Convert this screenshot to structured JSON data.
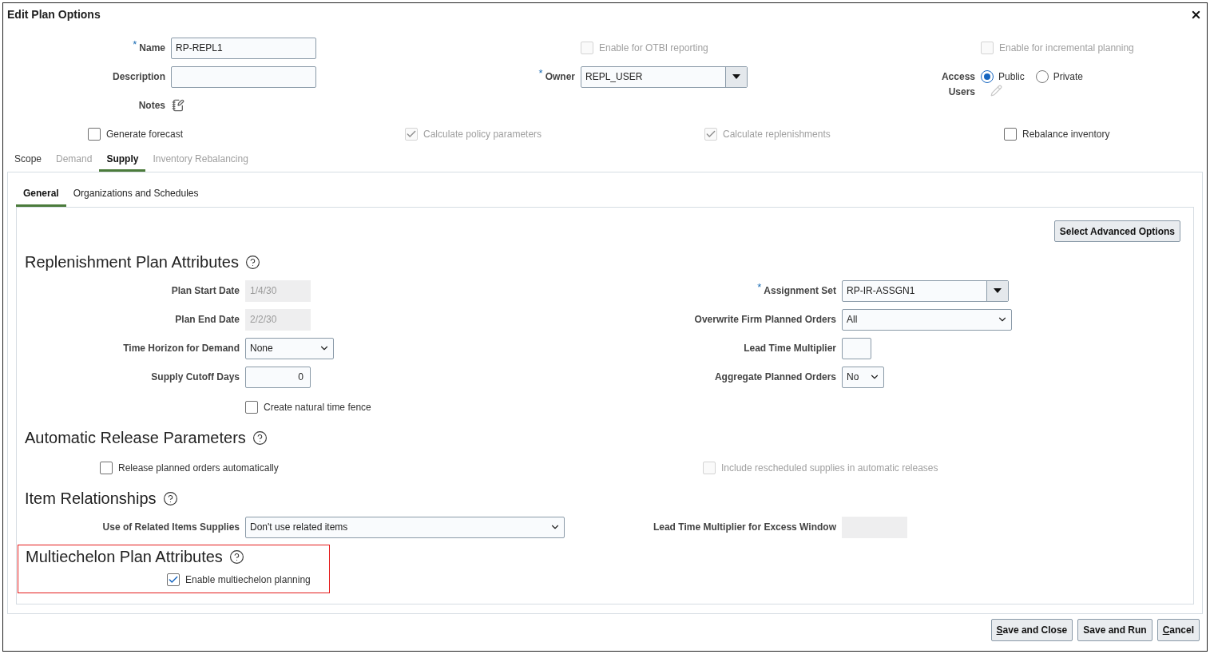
{
  "window": {
    "title": "Edit Plan Options"
  },
  "header": {
    "name": {
      "label": "Name",
      "required_mark": "*",
      "value": "RP-REPL1"
    },
    "description": {
      "label": "Description"
    },
    "notes": {
      "label": "Notes"
    },
    "otbi": {
      "label": "Enable for OTBI reporting",
      "checked": false,
      "disabled": true
    },
    "owner": {
      "label": "Owner",
      "required_mark": "*",
      "value": "REPL_USER"
    },
    "incremental": {
      "label": "Enable for incremental planning",
      "checked": false,
      "disabled": true
    },
    "access": {
      "label": "Access",
      "options": [
        {
          "label": "Public",
          "selected": true
        },
        {
          "label": "Private",
          "selected": false
        }
      ]
    },
    "users": {
      "label": "Users"
    }
  },
  "plan_options": [
    {
      "label": "Generate forecast",
      "checked": false,
      "disabled": false
    },
    {
      "label": "Calculate policy parameters",
      "checked": true,
      "disabled": true
    },
    {
      "label": "Calculate replenishments",
      "checked": true,
      "disabled": true
    },
    {
      "label": "Rebalance inventory",
      "checked": false,
      "disabled": false
    }
  ],
  "tabs": [
    {
      "label": "Scope",
      "selected": false,
      "disabled": false
    },
    {
      "label": "Demand",
      "selected": false,
      "disabled": true
    },
    {
      "label": "Supply",
      "selected": true,
      "disabled": false
    },
    {
      "label": "Inventory Rebalancing",
      "selected": false,
      "disabled": true
    }
  ],
  "subtabs": [
    {
      "label": "General",
      "selected": true
    },
    {
      "label": "Organizations and Schedules",
      "selected": false
    }
  ],
  "advanced_button": "Select Advanced Options",
  "sections": [
    {
      "title": "Replenishment Plan Attributes",
      "left": [
        {
          "kind": "readonly",
          "label": "Plan Start Date",
          "value": "1/4/30"
        },
        {
          "kind": "readonly",
          "label": "Plan End Date",
          "value": "2/2/30"
        },
        {
          "kind": "select",
          "label": "Time Horizon for Demand",
          "value": "None"
        },
        {
          "kind": "number",
          "label": "Supply Cutoff Days",
          "value": "0"
        },
        {
          "kind": "checkbox",
          "label": "Create natural time fence",
          "checked": false,
          "disabled": false
        }
      ],
      "right": [
        {
          "kind": "combo",
          "label": "Assignment Set",
          "required_mark": "*",
          "value": "RP-IR-ASSGN1"
        },
        {
          "kind": "select",
          "label": "Overwrite Firm Planned Orders",
          "value": "All"
        },
        {
          "kind": "text",
          "label": "Lead Time Multiplier"
        },
        {
          "kind": "select",
          "label": "Aggregate Planned Orders",
          "value": "No"
        }
      ]
    },
    {
      "title": "Automatic Release Parameters",
      "left": [
        {
          "kind": "checkbox",
          "label": "Release planned orders automatically",
          "checked": false,
          "disabled": false
        }
      ],
      "right": [
        {
          "kind": "checkbox",
          "label": "Include rescheduled supplies in automatic releases",
          "checked": false,
          "disabled": true
        }
      ]
    },
    {
      "title": "Item Relationships",
      "left": [
        {
          "kind": "select",
          "label": "Use of Related Items Supplies",
          "value": "Don't use related items"
        }
      ],
      "right": [
        {
          "kind": "readonly",
          "label": "Lead Time Multiplier for Excess Window"
        }
      ]
    },
    {
      "title": "Multiechelon Plan Attributes",
      "highlighted": true,
      "left": [
        {
          "kind": "checkbox",
          "label": "Enable multiechelon planning",
          "checked": true,
          "disabled": false
        }
      ]
    }
  ],
  "footer_buttons": [
    {
      "label": "Save and Close",
      "access_key": true
    },
    {
      "label": "Save and Run",
      "access_key": false
    },
    {
      "label": "Cancel",
      "access_key": true
    }
  ]
}
